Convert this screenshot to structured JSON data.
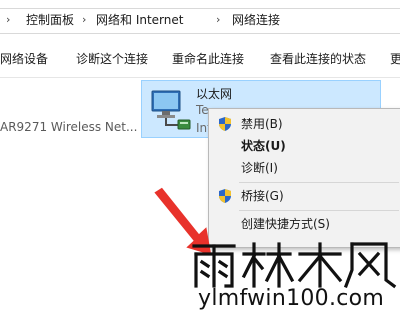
{
  "address_bar": {
    "crumbs": [
      "控制面板",
      "网络和 Internet",
      "网络连接"
    ],
    "separator": "›",
    "leading_arrow": "›"
  },
  "command_bar": {
    "items": [
      "网络设备",
      "诊断这个连接",
      "重命名此连接",
      "查看此连接的状态",
      "更"
    ]
  },
  "adapters": {
    "left_description": "AR9271 Wireless Net...",
    "selected": {
      "name": "以太网",
      "line1": "Te",
      "line2": "Int",
      "icon": "network-adapter-icon"
    }
  },
  "context_menu": {
    "items": [
      {
        "label": "禁用(B)",
        "shield": true,
        "bold": false
      },
      {
        "label": "状态(U)",
        "shield": false,
        "bold": true
      },
      {
        "label": "诊断(I)",
        "shield": false,
        "bold": false
      },
      {
        "label": "桥接(G)",
        "shield": true,
        "bold": false
      },
      {
        "label": "创建快捷方式(S)",
        "shield": false,
        "bold": false
      }
    ]
  },
  "watermark": {
    "logo_text": "雨林木风",
    "url": "ylmfwin100.com"
  },
  "colors": {
    "selection_bg": "#cce8ff",
    "selection_border": "#99d1ff",
    "menu_bg": "#f2f2f2",
    "arrow": "#e8322b"
  }
}
